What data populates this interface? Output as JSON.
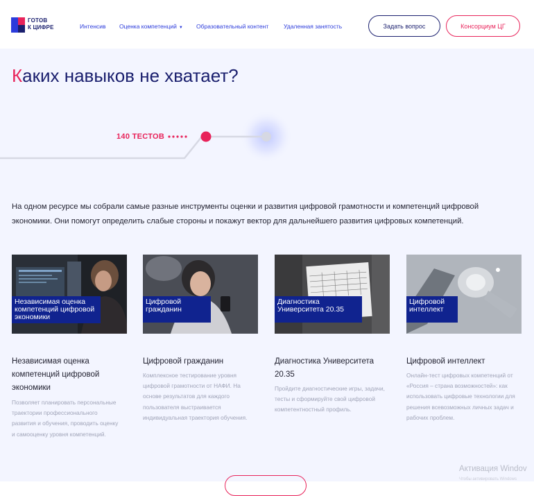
{
  "header": {
    "logo": {
      "line1": "ГОТОВ",
      "line2": "К ЦИФРЕ"
    },
    "nav": [
      {
        "label": "Интенсив"
      },
      {
        "label": "Оценка компетенций",
        "has_dropdown": true
      },
      {
        "label": "Образовательный контент"
      },
      {
        "label": "Удаленная занятость"
      }
    ],
    "ask_button": "Задать вопрос",
    "consortium_button": "Консорциум ЦГ"
  },
  "hero": {
    "title_first_letter": "К",
    "title_rest": "аких навыков не хватает?",
    "tests_label": "140 ТЕСТОВ",
    "intro": "На одном ресурсе мы собрали самые разные инструменты оценки и развития цифровой грамотности и компетенций цифровой экономики. Они помогут определить слабые стороны и покажут вектор для дальнейшего развития цифровых компетенций."
  },
  "cards": [
    {
      "tag": "Независимая оценка компетенций цифровой экономики",
      "title": "Независимая оценка компетенций цифровой экономики",
      "description": "Позволяет планировать персональные траектории профессионального развития и обучения, проводить оценку и самооценку уровня компетенций."
    },
    {
      "tag": "Цифровой гражданин",
      "title": "Цифровой гражданин",
      "description": "Комплексное тестирование уровня цифровой грамотности от НАФИ. На основе результатов для каждого пользователя выстраивается индивидуальная траектория обучения."
    },
    {
      "tag": "Диагностика Университета 20.35",
      "title": "Диагностика Университета 20.35",
      "description": "Пройдите диагностические игры, задачи, тесты и сформируйте свой цифровой компетентностный профиль."
    },
    {
      "tag": "Цифровой интеллект",
      "title": "Цифровой интеллект",
      "description": "Онлайн-тест цифровых компетенций от «Россия – страна возможностей»: как использовать цифровые технологии для решения всевозможных личных задач и рабочих проблем."
    }
  ],
  "os_overlay": {
    "watermark": "Активация Windov",
    "watermark_sub": "Чтобы активировать Windows"
  },
  "colors": {
    "accent_pink": "#e8235a",
    "brand_navy": "#1a1f6e",
    "nav_blue": "#2b3bdb",
    "tag_blue": "#10238f",
    "hero_bg": "#f3f5ff"
  }
}
